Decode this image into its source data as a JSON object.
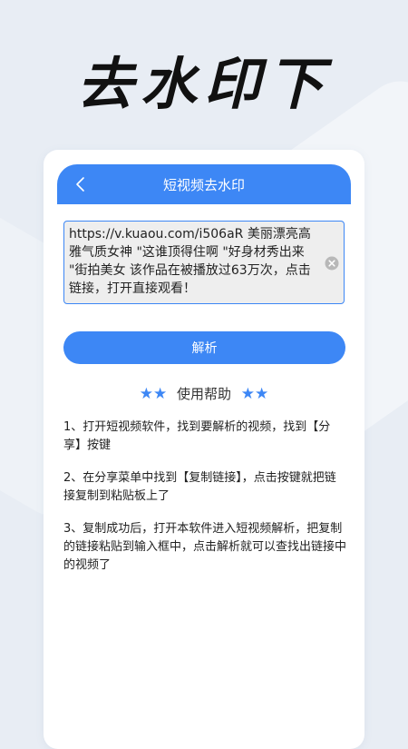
{
  "hero": {
    "title": "去水印下"
  },
  "header": {
    "back_icon": "chevron-left-icon",
    "title": "短视频去水印"
  },
  "input": {
    "value": "https://v.kuaou.com/i506aR 美丽漂亮高雅气质女神 \"这谁顶得住啊 \"好身材秀出来 \"街拍美女 该作品在被播放过63万次，点击链接，打开直接观看！",
    "clear_icon": "clear-circle-icon"
  },
  "parse_button": {
    "label": "解析"
  },
  "help": {
    "star_left": "★★",
    "title": "使用帮助",
    "star_right": "★★",
    "steps": [
      "1、打开短视频软件，找到要解析的视频，找到【分享】按键",
      "2、在分享菜单中找到【复制链接】，点击按键就把链接复制到粘贴板上了",
      "3、复制成功后，打开本软件进入短视频解析，把复制的链接粘贴到输入框中，点击解析就可以查找出链接中的视频了"
    ]
  },
  "colors": {
    "accent": "#3d87f5",
    "background": "#e8edf4",
    "card": "#ffffff",
    "input_bg": "#eeeeee"
  }
}
